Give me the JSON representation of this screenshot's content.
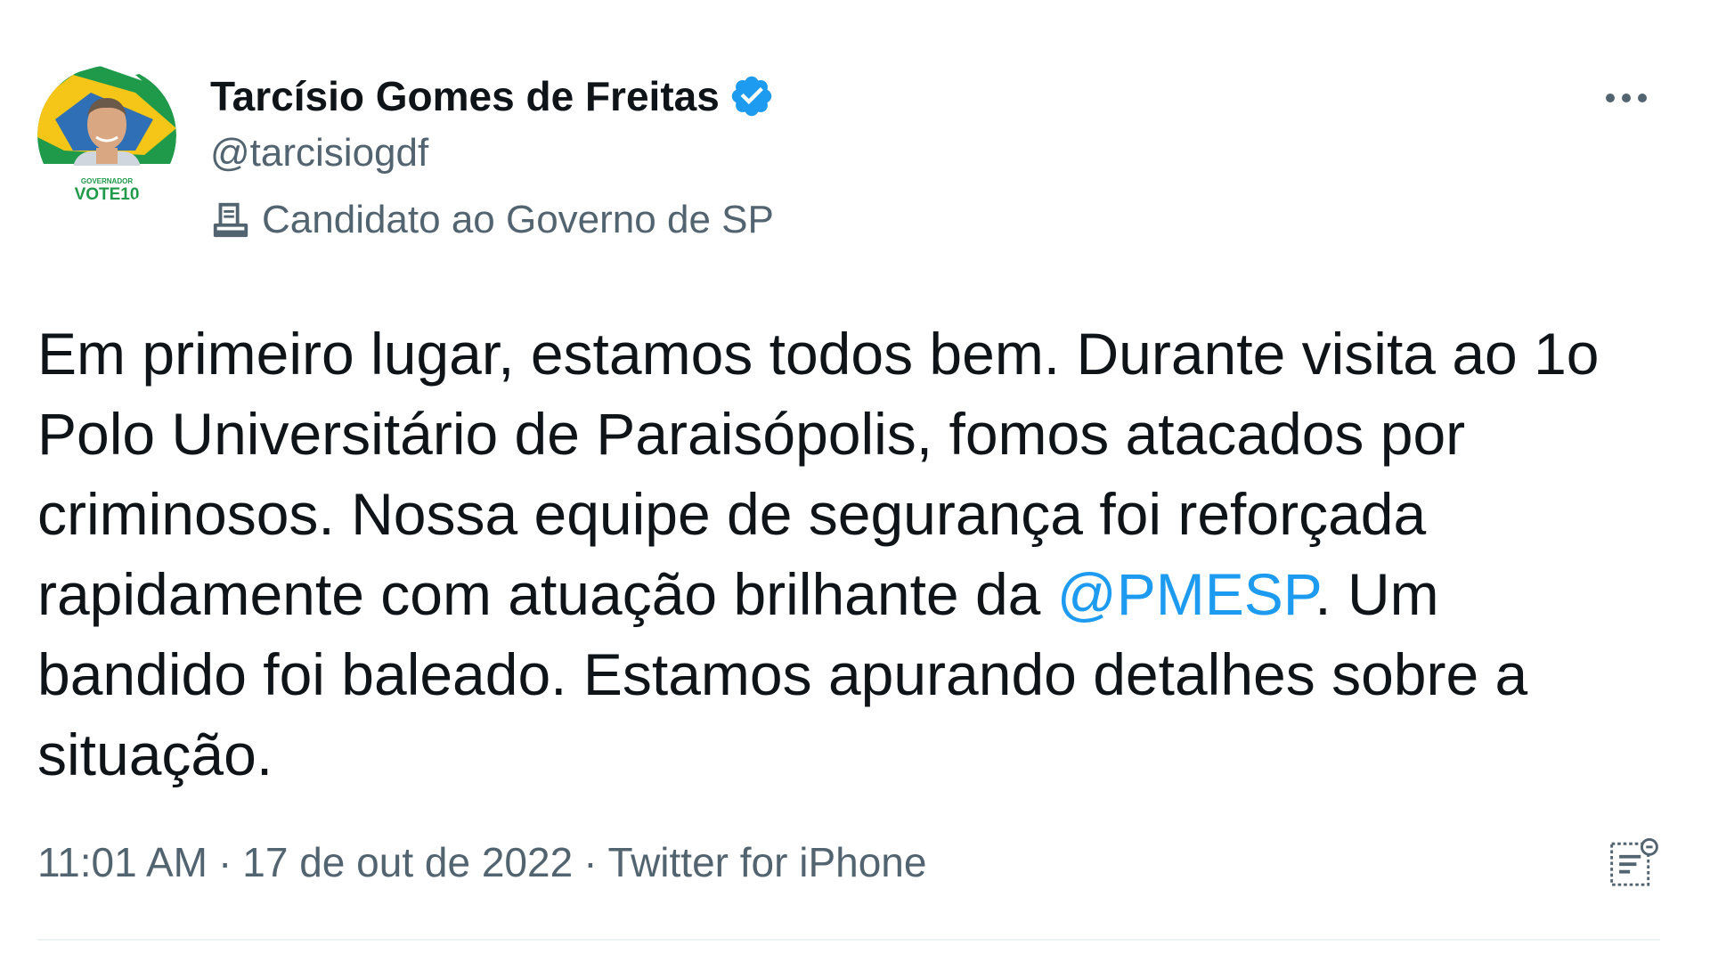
{
  "tweet": {
    "author": {
      "display_name": "Tarcísio Gomes de Freitas",
      "handle": "@tarcisiogdf",
      "verified": true,
      "label": "Candidato ao Governo de SP",
      "label_icon": "ballot-box-icon",
      "avatar_caption": "VOTE10"
    },
    "text": {
      "before_mention": "Em primeiro lugar, estamos todos bem. Durante visita ao 1o Polo Universitário de Paraisópolis, fomos atacados por criminosos. Nossa equipe de segurança foi reforçada rapidamente com atuação brilhante da ",
      "mention": "@PMESP",
      "after_mention": ". Um bandido foi baleado. Estamos apurando detalhes sobre a situação."
    },
    "meta": {
      "time": "11:01 AM",
      "separator": "·",
      "date": "17 de out de 2022",
      "source": "Twitter for iPhone"
    },
    "icons": {
      "more": "more-dots-icon",
      "verified": "verified-badge-icon",
      "analytics": "analytics-icon"
    }
  },
  "colors": {
    "primary_text": "#0f1419",
    "secondary_text": "#536471",
    "link": "#1d9bf0",
    "verified": "#1d9bf0",
    "divider": "#eff3f4"
  }
}
